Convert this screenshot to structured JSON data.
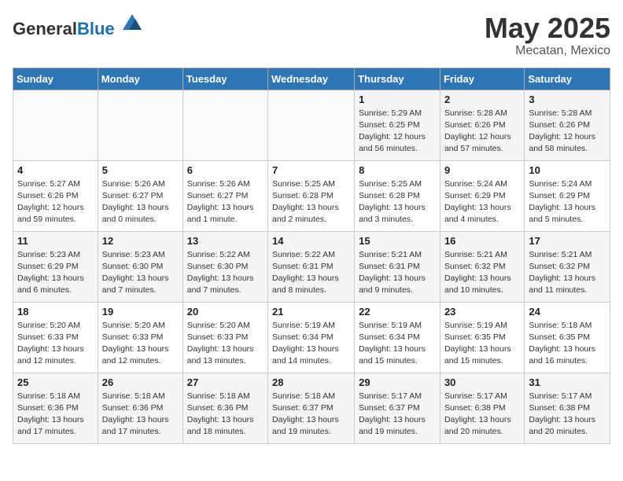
{
  "header": {
    "logo_general": "General",
    "logo_blue": "Blue",
    "title": "May 2025",
    "subtitle": "Mecatan, Mexico"
  },
  "days_of_week": [
    "Sunday",
    "Monday",
    "Tuesday",
    "Wednesday",
    "Thursday",
    "Friday",
    "Saturday"
  ],
  "weeks": [
    [
      {
        "day": "",
        "info": ""
      },
      {
        "day": "",
        "info": ""
      },
      {
        "day": "",
        "info": ""
      },
      {
        "day": "",
        "info": ""
      },
      {
        "day": "1",
        "info": "Sunrise: 5:29 AM\nSunset: 6:25 PM\nDaylight: 12 hours\nand 56 minutes."
      },
      {
        "day": "2",
        "info": "Sunrise: 5:28 AM\nSunset: 6:26 PM\nDaylight: 12 hours\nand 57 minutes."
      },
      {
        "day": "3",
        "info": "Sunrise: 5:28 AM\nSunset: 6:26 PM\nDaylight: 12 hours\nand 58 minutes."
      }
    ],
    [
      {
        "day": "4",
        "info": "Sunrise: 5:27 AM\nSunset: 6:26 PM\nDaylight: 12 hours\nand 59 minutes."
      },
      {
        "day": "5",
        "info": "Sunrise: 5:26 AM\nSunset: 6:27 PM\nDaylight: 13 hours\nand 0 minutes."
      },
      {
        "day": "6",
        "info": "Sunrise: 5:26 AM\nSunset: 6:27 PM\nDaylight: 13 hours\nand 1 minute."
      },
      {
        "day": "7",
        "info": "Sunrise: 5:25 AM\nSunset: 6:28 PM\nDaylight: 13 hours\nand 2 minutes."
      },
      {
        "day": "8",
        "info": "Sunrise: 5:25 AM\nSunset: 6:28 PM\nDaylight: 13 hours\nand 3 minutes."
      },
      {
        "day": "9",
        "info": "Sunrise: 5:24 AM\nSunset: 6:29 PM\nDaylight: 13 hours\nand 4 minutes."
      },
      {
        "day": "10",
        "info": "Sunrise: 5:24 AM\nSunset: 6:29 PM\nDaylight: 13 hours\nand 5 minutes."
      }
    ],
    [
      {
        "day": "11",
        "info": "Sunrise: 5:23 AM\nSunset: 6:29 PM\nDaylight: 13 hours\nand 6 minutes."
      },
      {
        "day": "12",
        "info": "Sunrise: 5:23 AM\nSunset: 6:30 PM\nDaylight: 13 hours\nand 7 minutes."
      },
      {
        "day": "13",
        "info": "Sunrise: 5:22 AM\nSunset: 6:30 PM\nDaylight: 13 hours\nand 7 minutes."
      },
      {
        "day": "14",
        "info": "Sunrise: 5:22 AM\nSunset: 6:31 PM\nDaylight: 13 hours\nand 8 minutes."
      },
      {
        "day": "15",
        "info": "Sunrise: 5:21 AM\nSunset: 6:31 PM\nDaylight: 13 hours\nand 9 minutes."
      },
      {
        "day": "16",
        "info": "Sunrise: 5:21 AM\nSunset: 6:32 PM\nDaylight: 13 hours\nand 10 minutes."
      },
      {
        "day": "17",
        "info": "Sunrise: 5:21 AM\nSunset: 6:32 PM\nDaylight: 13 hours\nand 11 minutes."
      }
    ],
    [
      {
        "day": "18",
        "info": "Sunrise: 5:20 AM\nSunset: 6:33 PM\nDaylight: 13 hours\nand 12 minutes."
      },
      {
        "day": "19",
        "info": "Sunrise: 5:20 AM\nSunset: 6:33 PM\nDaylight: 13 hours\nand 12 minutes."
      },
      {
        "day": "20",
        "info": "Sunrise: 5:20 AM\nSunset: 6:33 PM\nDaylight: 13 hours\nand 13 minutes."
      },
      {
        "day": "21",
        "info": "Sunrise: 5:19 AM\nSunset: 6:34 PM\nDaylight: 13 hours\nand 14 minutes."
      },
      {
        "day": "22",
        "info": "Sunrise: 5:19 AM\nSunset: 6:34 PM\nDaylight: 13 hours\nand 15 minutes."
      },
      {
        "day": "23",
        "info": "Sunrise: 5:19 AM\nSunset: 6:35 PM\nDaylight: 13 hours\nand 15 minutes."
      },
      {
        "day": "24",
        "info": "Sunrise: 5:18 AM\nSunset: 6:35 PM\nDaylight: 13 hours\nand 16 minutes."
      }
    ],
    [
      {
        "day": "25",
        "info": "Sunrise: 5:18 AM\nSunset: 6:36 PM\nDaylight: 13 hours\nand 17 minutes."
      },
      {
        "day": "26",
        "info": "Sunrise: 5:18 AM\nSunset: 6:36 PM\nDaylight: 13 hours\nand 17 minutes."
      },
      {
        "day": "27",
        "info": "Sunrise: 5:18 AM\nSunset: 6:36 PM\nDaylight: 13 hours\nand 18 minutes."
      },
      {
        "day": "28",
        "info": "Sunrise: 5:18 AM\nSunset: 6:37 PM\nDaylight: 13 hours\nand 19 minutes."
      },
      {
        "day": "29",
        "info": "Sunrise: 5:17 AM\nSunset: 6:37 PM\nDaylight: 13 hours\nand 19 minutes."
      },
      {
        "day": "30",
        "info": "Sunrise: 5:17 AM\nSunset: 6:38 PM\nDaylight: 13 hours\nand 20 minutes."
      },
      {
        "day": "31",
        "info": "Sunrise: 5:17 AM\nSunset: 6:38 PM\nDaylight: 13 hours\nand 20 minutes."
      }
    ]
  ]
}
